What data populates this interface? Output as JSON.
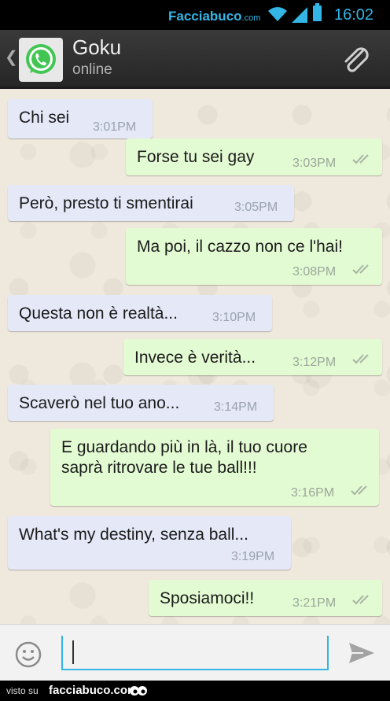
{
  "statusbar": {
    "brand": "Facciabuco",
    "brand_suffix": ".com",
    "clock": "16:02",
    "icons": [
      "wifi-icon",
      "signal-icon",
      "battery-icon"
    ]
  },
  "header": {
    "contact_name": "Goku",
    "status": "online",
    "icons": [
      "back-chevron-icon",
      "whatsapp-avatar-icon",
      "attach-paperclip-icon"
    ]
  },
  "colors": {
    "header_bg": "#2d2d2d",
    "incoming_bubble": "#e4e8f7",
    "outgoing_bubble": "#e3fbd3",
    "accent": "#33b5e5",
    "chat_bg": "#efe8dc"
  },
  "messages": [
    {
      "dir": "in",
      "text": "Chi sei",
      "time": "3:01PM"
    },
    {
      "dir": "out",
      "text": "Forse tu sei gay",
      "time": "3:03PM",
      "status": "read"
    },
    {
      "dir": "in",
      "text": "Però, presto ti smentirai",
      "time": "3:05PM"
    },
    {
      "dir": "out",
      "text": "Ma poi, il cazzo non ce l'hai!",
      "time": "3:08PM",
      "status": "read"
    },
    {
      "dir": "in",
      "text": "Questa non è realtà...",
      "time": "3:10PM"
    },
    {
      "dir": "out",
      "text": "Invece è verità...",
      "time": "3:12PM",
      "status": "read"
    },
    {
      "dir": "in",
      "text": "Scaverò nel tuo ano...",
      "time": "3:14PM"
    },
    {
      "dir": "out",
      "text": "E guardando più in là, il tuo cuore",
      "text2": "saprà ritrovare le tue ball!!!",
      "time": "3:16PM",
      "status": "read"
    },
    {
      "dir": "in",
      "text": "What's my destiny, senza ball...",
      "time": "3:19PM"
    },
    {
      "dir": "out",
      "text": "Sposiamoci!!",
      "time": "3:21PM",
      "status": "read"
    }
  ],
  "composer": {
    "value": "",
    "icons": [
      "smiley-icon",
      "send-icon"
    ]
  },
  "footer": {
    "visto": "visto su",
    "site": "facciabuco.com"
  }
}
